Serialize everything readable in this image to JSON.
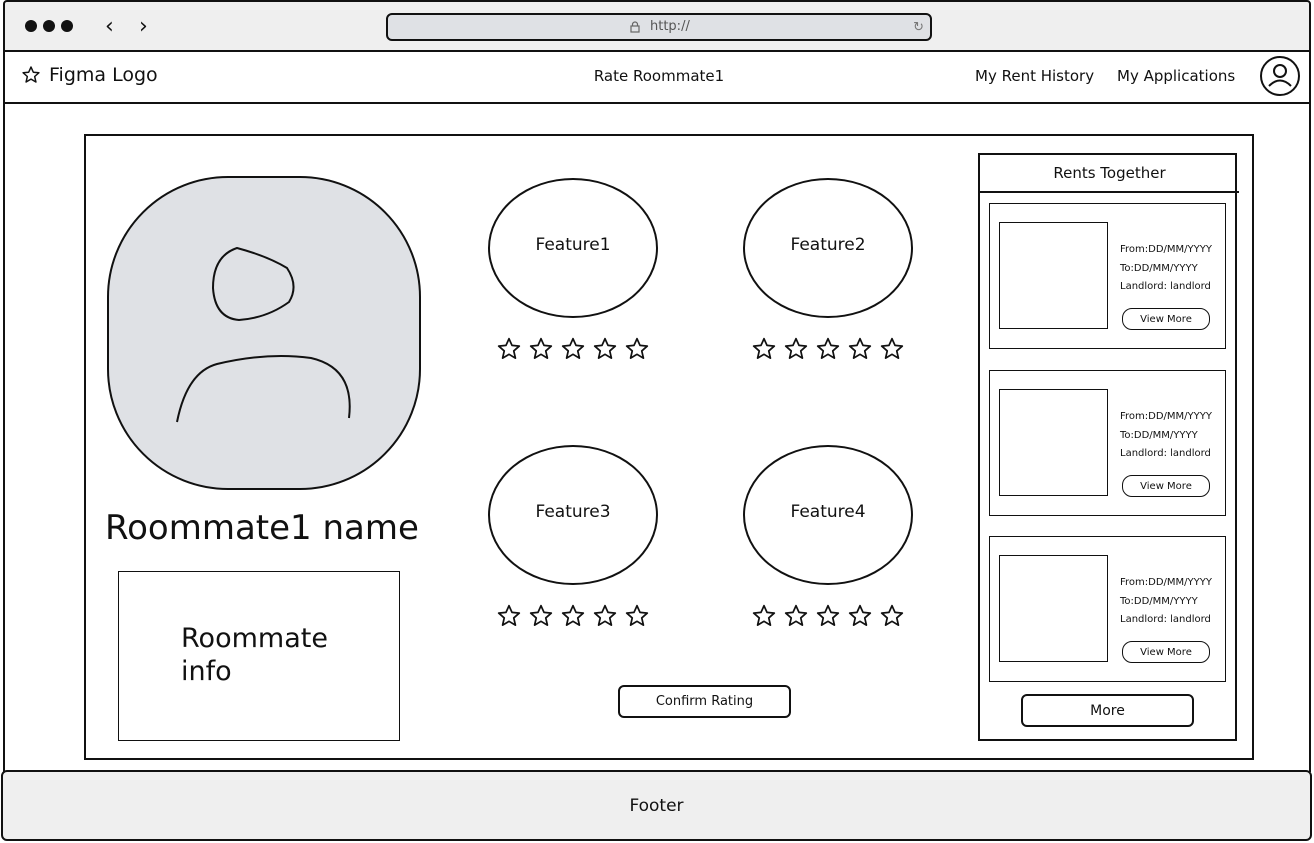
{
  "browser": {
    "url": "http://"
  },
  "topnav": {
    "logo_label": "Figma Logo",
    "page_title": "Rate Roommate1",
    "rent_history_link": "My Rent History",
    "applications_link": "My Applications"
  },
  "profile": {
    "name": "Roommate1 name",
    "info": "Roommate info"
  },
  "features": [
    {
      "label": "Feature1",
      "rating_max": 5,
      "rating": 0
    },
    {
      "label": "Feature2",
      "rating_max": 5,
      "rating": 0
    },
    {
      "label": "Feature3",
      "rating_max": 5,
      "rating": 0
    },
    {
      "label": "Feature4",
      "rating_max": 5,
      "rating": 0
    }
  ],
  "confirm_label": "Confirm Rating",
  "rents": {
    "title": "Rents Together",
    "items": [
      {
        "from": "From:DD/MM/YYYY",
        "to": "To:DD/MM/YYYY",
        "landlord": "Landlord: landlord",
        "view_more": "View More"
      },
      {
        "from": "From:DD/MM/YYYY",
        "to": "To:DD/MM/YYYY",
        "landlord": "Landlord: landlord",
        "view_more": "View More"
      },
      {
        "from": "From:DD/MM/YYYY",
        "to": "To:DD/MM/YYYY",
        "landlord": "Landlord: landlord",
        "view_more": "View More"
      }
    ],
    "more_label": "More"
  },
  "footer": {
    "label": "Footer"
  },
  "colors": {
    "chrome_bg": "#efefef",
    "photo_bg": "#dfe1e5",
    "stroke": "#111111"
  }
}
